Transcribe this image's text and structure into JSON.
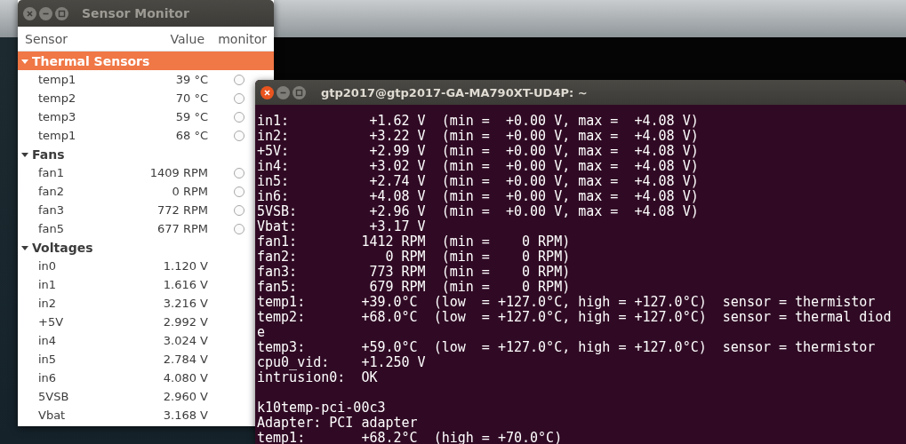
{
  "sensor_window": {
    "title": "Sensor Monitor",
    "columns": [
      "Sensor",
      "Value",
      "monitor"
    ],
    "groups": [
      {
        "label": "Thermal Sensors",
        "expanded": true,
        "selected": true,
        "sensors": [
          {
            "name": "temp1",
            "value": "39 °C",
            "monitored": false
          },
          {
            "name": "temp2",
            "value": "70 °C",
            "monitored": false
          },
          {
            "name": "temp3",
            "value": "59 °C",
            "monitored": false
          },
          {
            "name": "temp1",
            "value": "68 °C",
            "monitored": false
          }
        ]
      },
      {
        "label": "Fans",
        "expanded": true,
        "selected": false,
        "sensors": [
          {
            "name": "fan1",
            "value": "1409 RPM",
            "monitored": false
          },
          {
            "name": "fan2",
            "value": "0 RPM",
            "monitored": false
          },
          {
            "name": "fan3",
            "value": "772 RPM",
            "monitored": false
          },
          {
            "name": "fan5",
            "value": "677 RPM",
            "monitored": false
          }
        ]
      },
      {
        "label": "Voltages",
        "expanded": true,
        "selected": false,
        "sensors": [
          {
            "name": "in0",
            "value": "1.120 V"
          },
          {
            "name": "in1",
            "value": "1.616 V"
          },
          {
            "name": "in2",
            "value": "3.216 V"
          },
          {
            "name": "+5V",
            "value": "2.992 V"
          },
          {
            "name": "in4",
            "value": "3.024 V"
          },
          {
            "name": "in5",
            "value": "2.784 V"
          },
          {
            "name": "in6",
            "value": "4.080 V"
          },
          {
            "name": "5VSB",
            "value": "2.960 V"
          },
          {
            "name": "Vbat",
            "value": "3.168 V"
          }
        ]
      }
    ]
  },
  "terminal": {
    "title": "gtp2017@gtp2017-GA-MA790XT-UD4P: ~",
    "blocks": [
      [
        "in1:          +1.62 V  (min =  +0.00 V, max =  +4.08 V)",
        "in2:          +3.22 V  (min =  +0.00 V, max =  +4.08 V)",
        "+5V:          +2.99 V  (min =  +0.00 V, max =  +4.08 V)",
        "in4:          +3.02 V  (min =  +0.00 V, max =  +4.08 V)",
        "in5:          +2.74 V  (min =  +0.00 V, max =  +4.08 V)",
        "in6:          +4.08 V  (min =  +0.00 V, max =  +4.08 V)",
        "5VSB:         +2.96 V  (min =  +0.00 V, max =  +4.08 V)",
        "Vbat:         +3.17 V",
        "fan1:        1412 RPM  (min =    0 RPM)",
        "fan2:           0 RPM  (min =    0 RPM)",
        "fan3:         773 RPM  (min =    0 RPM)",
        "fan5:         679 RPM  (min =    0 RPM)",
        "temp1:       +39.0°C  (low  = +127.0°C, high = +127.0°C)  sensor = thermistor",
        "temp2:       +68.0°C  (low  = +127.0°C, high = +127.0°C)  sensor = thermal diod",
        "e",
        "temp3:       +59.0°C  (low  = +127.0°C, high = +127.0°C)  sensor = thermistor",
        "cpu0_vid:    +1.250 V",
        "intrusion0:  OK"
      ],
      [
        "k10temp-pci-00c3",
        "Adapter: PCI adapter",
        "temp1:       +68.2°C  (high = +70.0°C)"
      ]
    ]
  }
}
